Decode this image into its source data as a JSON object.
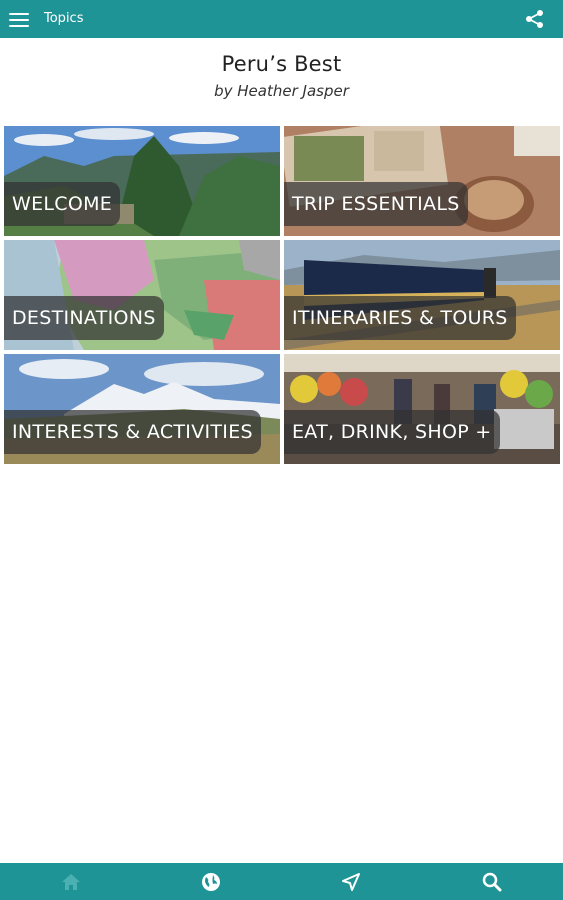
{
  "topbar": {
    "title": "Topics"
  },
  "header": {
    "title": "Peru’s Best",
    "author": "by Heather Jasper"
  },
  "tiles": [
    {
      "label": "WELCOME"
    },
    {
      "label": "TRIP ESSENTIALS"
    },
    {
      "label": "DESTINATIONS"
    },
    {
      "label": "ITINERARIES & TOURS"
    },
    {
      "label": "INTERESTS & ACTIVITIES"
    },
    {
      "label": "EAT, DRINK, SHOP +"
    }
  ],
  "bottom_nav": [
    {
      "icon": "home-icon"
    },
    {
      "icon": "globe-icon"
    },
    {
      "icon": "navigation-arrow-icon"
    },
    {
      "icon": "search-icon"
    }
  ],
  "colors": {
    "accent": "#1f9497",
    "label_bg": "#323232"
  }
}
